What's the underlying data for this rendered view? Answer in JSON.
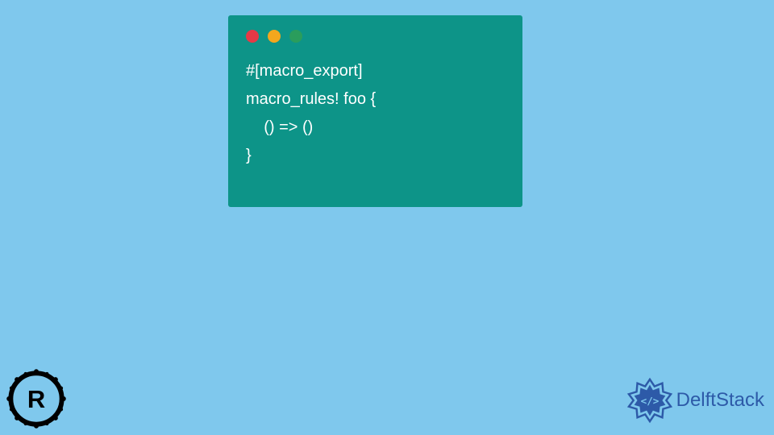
{
  "code": {
    "lines": [
      "#[macro_export]",
      "macro_rules! foo {",
      "    () => ()",
      "}"
    ]
  },
  "branding": {
    "site_name": "DelftStack"
  },
  "colors": {
    "background": "#7fc8ed",
    "code_bg": "#0d9488",
    "code_text": "#ffffff",
    "rust_black": "#000000",
    "delft_blue": "#2d5aa8"
  }
}
